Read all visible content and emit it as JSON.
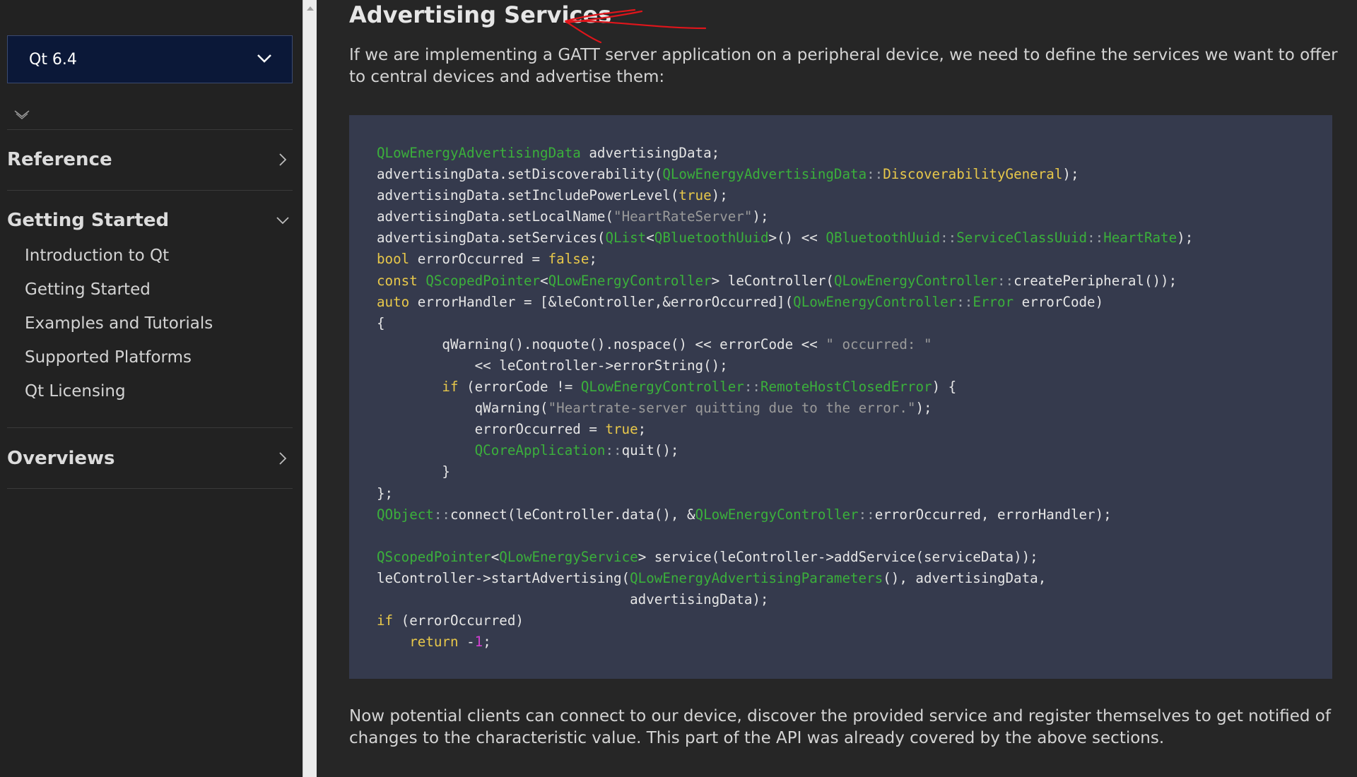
{
  "sidebar": {
    "version": "Qt 6.4",
    "sections": [
      {
        "title": "Reference",
        "expanded": false
      },
      {
        "title": "Getting Started",
        "expanded": true,
        "items": [
          "Introduction to Qt",
          "Getting Started",
          "Examples and Tutorials",
          "Supported Platforms",
          "Qt Licensing"
        ]
      },
      {
        "title": "Overviews",
        "expanded": false
      }
    ]
  },
  "main": {
    "title": "Advertising Services",
    "intro": "If we are implementing a GATT server application on a peripheral device, we need to define the services we want to offer to central devices and advertise them:",
    "outro": "Now potential clients can connect to our device, discover the provided service and register themselves to get notified of changes to the characteristic value. This part of the API was already covered by the above sections.",
    "annotation_color": "#e0151b",
    "code": [
      [
        [
          "type",
          "QLowEnergyAdvertisingData"
        ],
        [
          "plain",
          " advertisingData;"
        ]
      ],
      [
        [
          "plain",
          "advertisingData.setDiscoverability("
        ],
        [
          "type",
          "QLowEnergyAdvertisingData"
        ],
        [
          "op",
          "::"
        ],
        [
          "kw",
          "DiscoverabilityGeneral"
        ],
        [
          "plain",
          ");"
        ]
      ],
      [
        [
          "plain",
          "advertisingData.setIncludePowerLevel("
        ],
        [
          "kw",
          "true"
        ],
        [
          "plain",
          ");"
        ]
      ],
      [
        [
          "plain",
          "advertisingData.setLocalName("
        ],
        [
          "str",
          "\"HeartRateServer\""
        ],
        [
          "plain",
          ");"
        ]
      ],
      [
        [
          "plain",
          "advertisingData.setServices("
        ],
        [
          "type",
          "QList"
        ],
        [
          "plain",
          "<"
        ],
        [
          "type",
          "QBluetoothUuid"
        ],
        [
          "plain",
          ">() << "
        ],
        [
          "type",
          "QBluetoothUuid"
        ],
        [
          "op",
          "::"
        ],
        [
          "type",
          "ServiceClassUuid"
        ],
        [
          "op",
          "::"
        ],
        [
          "type",
          "HeartRate"
        ],
        [
          "plain",
          ");"
        ]
      ],
      [
        [
          "kw",
          "bool"
        ],
        [
          "plain",
          " errorOccurred = "
        ],
        [
          "kw",
          "false"
        ],
        [
          "plain",
          ";"
        ]
      ],
      [
        [
          "kw",
          "const"
        ],
        [
          "plain",
          " "
        ],
        [
          "type",
          "QScopedPointer"
        ],
        [
          "plain",
          "<"
        ],
        [
          "type",
          "QLowEnergyController"
        ],
        [
          "plain",
          "> leController("
        ],
        [
          "type",
          "QLowEnergyController"
        ],
        [
          "op",
          "::"
        ],
        [
          "plain",
          "createPeripheral());"
        ]
      ],
      [
        [
          "kw",
          "auto"
        ],
        [
          "plain",
          " errorHandler = [&leController,&errorOccurred]("
        ],
        [
          "type",
          "QLowEnergyController"
        ],
        [
          "op",
          "::"
        ],
        [
          "type",
          "Error"
        ],
        [
          "plain",
          " errorCode)"
        ]
      ],
      [
        [
          "plain",
          "{"
        ]
      ],
      [
        [
          "plain",
          "        qWarning().noquote().nospace() << errorCode << "
        ],
        [
          "str",
          "\" occurred: \""
        ]
      ],
      [
        [
          "plain",
          "            << leController->errorString();"
        ]
      ],
      [
        [
          "plain",
          "        "
        ],
        [
          "kw",
          "if"
        ],
        [
          "plain",
          " (errorCode != "
        ],
        [
          "type",
          "QLowEnergyController"
        ],
        [
          "op",
          "::"
        ],
        [
          "type",
          "RemoteHostClosedError"
        ],
        [
          "plain",
          ") {"
        ]
      ],
      [
        [
          "plain",
          "            qWarning("
        ],
        [
          "str",
          "\"Heartrate-server quitting due to the error.\""
        ],
        [
          "plain",
          ");"
        ]
      ],
      [
        [
          "plain",
          "            errorOccurred = "
        ],
        [
          "kw",
          "true"
        ],
        [
          "plain",
          ";"
        ]
      ],
      [
        [
          "plain",
          "            "
        ],
        [
          "type",
          "QCoreApplication"
        ],
        [
          "op",
          "::"
        ],
        [
          "plain",
          "quit();"
        ]
      ],
      [
        [
          "plain",
          "        }"
        ]
      ],
      [
        [
          "plain",
          "};"
        ]
      ],
      [
        [
          "type",
          "QObject"
        ],
        [
          "op",
          "::"
        ],
        [
          "plain",
          "connect(leController.data(), &"
        ],
        [
          "type",
          "QLowEnergyController"
        ],
        [
          "op",
          "::"
        ],
        [
          "plain",
          "errorOccurred, errorHandler);"
        ]
      ],
      [],
      [
        [
          "type",
          "QScopedPointer"
        ],
        [
          "plain",
          "<"
        ],
        [
          "type",
          "QLowEnergyService"
        ],
        [
          "plain",
          "> service(leController->addService(serviceData));"
        ]
      ],
      [
        [
          "plain",
          "leController->startAdvertising("
        ],
        [
          "type",
          "QLowEnergyAdvertisingParameters"
        ],
        [
          "plain",
          "(), advertisingData,"
        ]
      ],
      [
        [
          "plain",
          "                               advertisingData);"
        ]
      ],
      [
        [
          "kw",
          "if"
        ],
        [
          "plain",
          " (errorOccurred)"
        ]
      ],
      [
        [
          "plain",
          "    "
        ],
        [
          "kw",
          "return"
        ],
        [
          "plain",
          " -"
        ],
        [
          "num",
          "1"
        ],
        [
          "plain",
          ";"
        ]
      ]
    ]
  }
}
